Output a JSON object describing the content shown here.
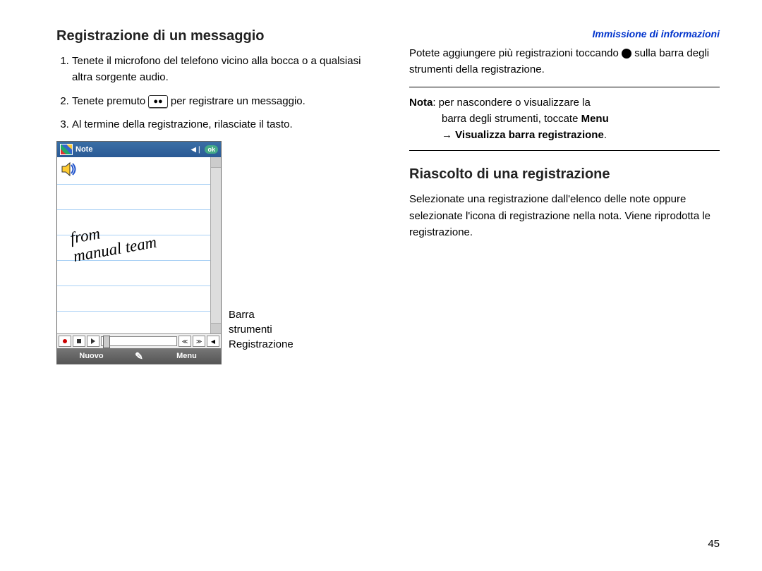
{
  "breadcrumb": "Immissione di informazioni",
  "left": {
    "heading": "Registrazione di un messaggio",
    "steps": {
      "s1": "Tenete il microfono del telefono vicino alla bocca o a qualsiasi altra sorgente audio.",
      "s2a": "Tenete premuto ",
      "s2_icon": "⏺⏺",
      "s2b": " per registrare un messaggio.",
      "s3": "Al termine della registrazione, rilasciate il tasto."
    },
    "screenshot": {
      "title": "Note",
      "ok": "ok",
      "handwriting_l1": "from",
      "handwriting_l2": "manual  team",
      "soft_left": "Nuovo",
      "soft_mid": "✎",
      "soft_right": "Menu"
    },
    "caption_l1": "Barra",
    "caption_l2": "strumenti",
    "caption_l3": "Registrazione"
  },
  "right": {
    "para1a": "Potete aggiungere più registrazioni toccando ",
    "para1b": " sulla barra degli strumenti della registrazione.",
    "note_label": "Nota",
    "note_body1": ": per nascondere o visualizzare la",
    "note_body2": "barra degli strumenti, toccate ",
    "note_menu": "Menu",
    "note_body3": "→ ",
    "note_vis": "Visualizza barra registrazione",
    "note_body4": ".",
    "heading2": "Riascolto di una registrazione",
    "para2": "Selezionate una registrazione dall'elenco delle note oppure selezionate l'icona di registrazione nella nota. Viene riprodotta le registrazione."
  },
  "page_number": "45"
}
